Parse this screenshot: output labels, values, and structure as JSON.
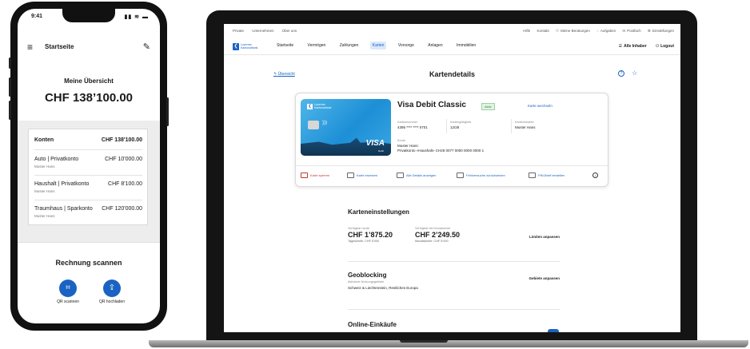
{
  "phone": {
    "time": "9:41",
    "header_title": "Startseite",
    "overview_label": "Meine Übersicht",
    "total": "CHF 138’100.00",
    "accounts": {
      "title": "Konten",
      "total": "CHF 138'100.00",
      "items": [
        {
          "name": "Auto | Privatkonto",
          "owner": "Muster Hans",
          "amount": "CHF 10'000.00"
        },
        {
          "name": "Haushalt | Privatkonto",
          "owner": "Muster Hans",
          "amount": "CHF 8'100.00"
        },
        {
          "name": "Traumhaus | Sparkonto",
          "owner": "Muster Hans",
          "amount": "CHF 120'000.00"
        }
      ]
    },
    "scan_title": "Rechnung scannen",
    "actions": [
      {
        "label": "QR scannen",
        "icon": "qr-scan-icon"
      },
      {
        "label": "QR hochladen",
        "icon": "upload-icon"
      }
    ]
  },
  "web": {
    "topbar_left": [
      "Private",
      "Unternehmen",
      "Über uns"
    ],
    "topbar_right": [
      "Hilfe",
      "Kontakt",
      "Meine Beratungen",
      "Aufgaben",
      "Postfach",
      "Einstellungen"
    ],
    "logo_text": "Luzerner Kantonalbank",
    "nav": [
      "Startseite",
      "Vermögen",
      "Zahlungen",
      "Karten",
      "Vorsorge",
      "Anlagen",
      "Immobilien"
    ],
    "nav_active_index": 3,
    "nav_right": {
      "filter": "Alle Inhaber",
      "logout": "Logout"
    },
    "back_link": "Übersicht",
    "page_title": "Kartendetails",
    "card": {
      "name": "Visa Debit Classic",
      "status": "Aktiv",
      "change_link": "Karte wechseln",
      "visual_bank": "Luzerner Kantonalbank",
      "visual_brand": "VISA",
      "visual_type": "Debit",
      "number_label": "Kartennummer",
      "number": "4395 **** **** 0701",
      "validity_label": "Kartengültigkeit",
      "validity": "12/28",
      "holder_label": "Karteninhaber",
      "holder": "Muster Hans",
      "account_label": "Konto",
      "account_owner": "Muster Hans:",
      "account": "Privatkonto «Haushalt» CH26 0077 0000 0000 0000 1"
    },
    "card_actions": [
      "Karte sperren",
      "Karte ersetzen",
      "Alle Details anzeigen",
      "Fehlversuche zurücksetzen",
      "PIN-Brief bestellen"
    ],
    "settings_title": "Karteneinstellungen",
    "limits": [
      {
        "label": "Verfügbar heute",
        "value": "CHF 1’875.20",
        "sub": "Tageslimite: CHF 5’000"
      },
      {
        "label": "Verfügbar bis Monatsende",
        "value": "CHF 2’249.50",
        "sub": "Monatslimite: CHF 5’000"
      }
    ],
    "limits_button": "Limiten anpassen",
    "geo": {
      "title": "Geoblocking",
      "sub": "Aktivierte Nutzungsgebiete",
      "text": "Schweiz & Liechtenstein, Restliches Europa",
      "button": "Gebiete anpassen"
    },
    "online_title": "Online-Einkäufe"
  },
  "colors": {
    "accent": "#1a63c2",
    "danger": "#c0392b",
    "success": "#2f8a3e"
  }
}
